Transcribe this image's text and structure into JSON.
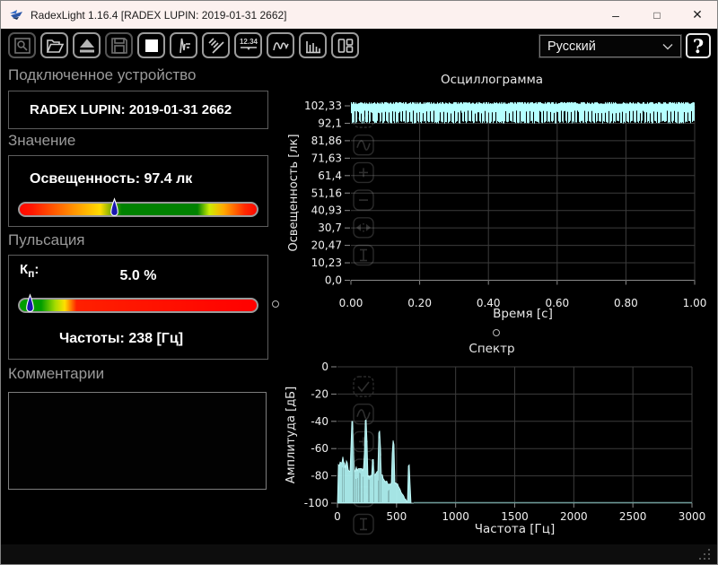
{
  "window": {
    "title": "RadexLight 1.16.4 [RADEX LUPIN: 2019-01-31 2662]",
    "minimize": "–",
    "maximize": "□",
    "close": "✕"
  },
  "toolbar": {
    "display_icon_label": "12.34",
    "language": "Русский",
    "help_label": "?"
  },
  "device_panel": {
    "label": "Подключенное устройство",
    "device": "RADEX LUPIN: 2019-01-31 2662"
  },
  "value_panel": {
    "label": "Значение",
    "reading": "Освещенность: 97.4 лк",
    "marker_pos_pct": 40,
    "gradient": "linear-gradient(to right,#ff0800 0%,#ff1700 5%,#ff9501 23%,#ffdd00 34%,#008100 43%,#008100 75%,#ccec02 80%,#ffaa00 86%,#ff2a00 95%,#ff0800 100%)"
  },
  "pulsation_panel": {
    "label": "Пульсация",
    "kp_main": "К",
    "kp_sub": "п",
    "kp_colon": ":",
    "kp_value": "5.0 %",
    "marker_pos_pct": 5,
    "frequency": "Частоты: 238 [Гц]",
    "gradient": "linear-gradient(to right,#009d00 0%,#009d00 9%,#a6dc00 15%,#ffe000 19%,#ff2000 24%,#ff0000 100%)"
  },
  "comments_panel": {
    "label": "Комментарии",
    "text": ""
  },
  "chart_data": [
    {
      "type": "line",
      "title": "Осциллограмма",
      "xlabel": "Время [с]",
      "ylabel": "Освещенность [лк]",
      "xlim": [
        0,
        1
      ],
      "ylim": [
        0,
        102.33
      ],
      "x_tick_labels": [
        "0.00",
        "0.20",
        "0.40",
        "0.60",
        "0.80",
        "1.00"
      ],
      "y_tick_labels": [
        "0,0",
        "10,23",
        "20,47",
        "30,7",
        "40,93",
        "51,16",
        "61,4",
        "71,63",
        "81,86",
        "92,1",
        "102,33"
      ],
      "series": [
        {
          "name": "illuminance",
          "character": "dense 100 Hz flicker band",
          "mean_lux": 97.4,
          "band_top_lux": 104.2,
          "band_bottom_lux": 92.0,
          "solid_bottom_lux": 99.6
        }
      ],
      "grid": true,
      "color": "#b5ffff"
    },
    {
      "type": "area",
      "title": "Спектр",
      "xlabel": "Частота [Гц]",
      "ylabel": "Амплитуда [дБ]",
      "xlim": [
        0,
        3000
      ],
      "ylim": [
        -100,
        0
      ],
      "x_tick_labels": [
        "0",
        "500",
        "1000",
        "1500",
        "2000",
        "2500",
        "3000"
      ],
      "y_tick_labels": [
        "0",
        "-20",
        "-40",
        "-60",
        "-80",
        "-100"
      ],
      "noise_floor": {
        "plateau_db": -74,
        "plateau_end_hz": 210,
        "db_at_cutoff": -94,
        "cutoff_hz": 600,
        "floor_db": -100
      },
      "peaks": [
        {
          "hz": 45,
          "db": -66
        },
        {
          "hz": 78,
          "db": -69
        },
        {
          "hz": 125,
          "db": -40
        },
        {
          "hz": 240,
          "db": -39
        },
        {
          "hz": 300,
          "db": -68
        },
        {
          "hz": 355,
          "db": -47
        },
        {
          "hz": 472,
          "db": -54
        },
        {
          "hz": 605,
          "db": -72
        }
      ],
      "grid": true,
      "color": "#b5ffff"
    }
  ]
}
